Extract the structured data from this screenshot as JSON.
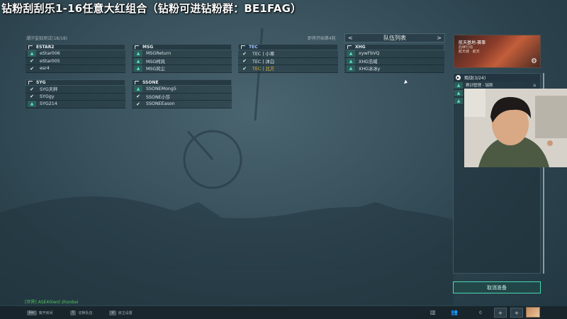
{
  "overlay": {
    "title": "钻粉刮刮乐1-16任意大红组合（钻粉可进钻粉群：BE1FAG）"
  },
  "lobby": {
    "name": "潮汐监狱测试(18/18)",
    "countdown": "即将开始第4轮"
  },
  "teams": [
    {
      "name": "ESTAR2",
      "highlight": false,
      "players": [
        {
          "name": "eStar006",
          "status": "triangle"
        },
        {
          "name": "eStar005",
          "status": "check"
        },
        {
          "name": "esr4",
          "status": "check"
        }
      ]
    },
    {
      "name": "MSG",
      "highlight": false,
      "players": [
        {
          "name": "MSGReturn",
          "status": "triangle"
        },
        {
          "name": "MSG柯风",
          "status": "triangle"
        },
        {
          "name": "MSG风尘",
          "status": "triangle"
        }
      ]
    },
    {
      "name": "TEC",
      "highlight": true,
      "players": [
        {
          "name": "TEC丨小寒",
          "status": "check"
        },
        {
          "name": "TEC丨沐白",
          "status": "check"
        },
        {
          "name": "TEC丨北方",
          "status": "check",
          "gold": true
        }
      ]
    },
    {
      "name": "XHG",
      "highlight": false,
      "players": [
        {
          "name": "xywFbVQ",
          "status": "triangle"
        },
        {
          "name": "XHG浩域",
          "status": "triangle"
        },
        {
          "name": "XHG冰冰y",
          "status": "triangle"
        }
      ]
    },
    {
      "name": "SYG",
      "highlight": false,
      "players": [
        {
          "name": "SYG天秤",
          "status": "check"
        },
        {
          "name": "SYGgy",
          "status": "check"
        },
        {
          "name": "SYG214",
          "status": "triangle"
        }
      ]
    },
    {
      "name": "SSONE",
      "highlight": false,
      "players": [
        {
          "name": "SSONEMong5",
          "status": "triangle"
        },
        {
          "name": "SSONE小莎",
          "status": "check"
        },
        {
          "name": "SSONEEason",
          "status": "check"
        }
      ]
    }
  ],
  "team_list": {
    "title": "队伍列表",
    "prev": "<",
    "next": ">"
  },
  "video": {
    "title": "航天基地-赛事",
    "subtitle": "后续行动",
    "subtitle2": "航天城 · 航天"
  },
  "viewers": {
    "label": "观战(3/24)",
    "first": "赛训管理 - 瑞斯"
  },
  "cancel_button": "取消准备",
  "chat_log": "[世界] ASE40iwnl zhonbei",
  "hints": [
    {
      "key": "Esc",
      "label": "离开房间"
    },
    {
      "key": "T",
      "label": "切换队伍"
    },
    {
      "key": "U",
      "label": "房主设置"
    }
  ],
  "bottom_right": {
    "count": "0",
    "plus1": "+",
    "plus2": "+"
  },
  "colors": {
    "accent": "#4ad6b2",
    "gold": "#e6b43c",
    "status_green": "#58e0c8"
  }
}
